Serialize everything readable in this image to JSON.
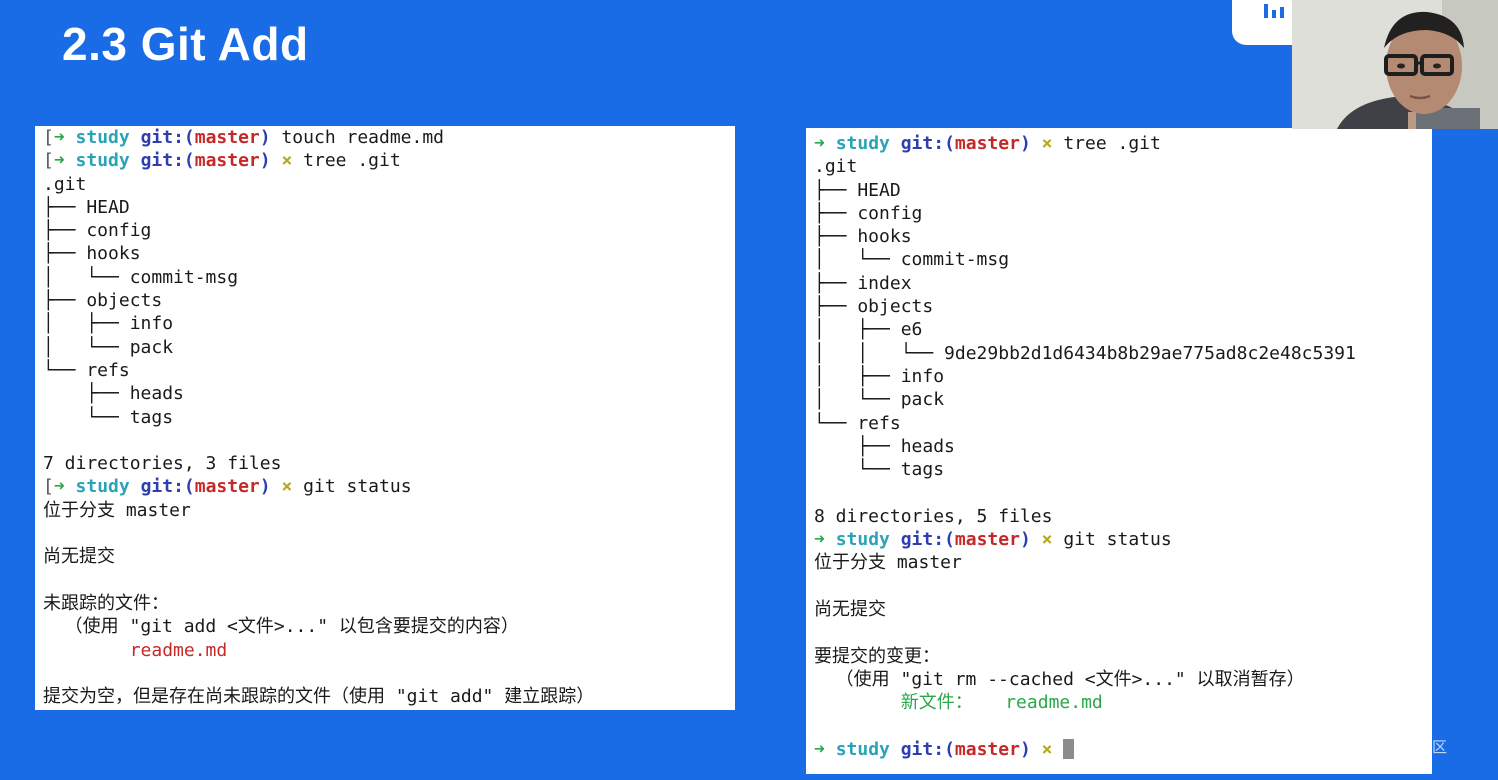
{
  "slide": {
    "title": "2.3 Git Add",
    "watermark": "@稀土掘金技术社区"
  },
  "colors": {
    "background": "#1a6ce6",
    "prompt_arrow": "#2aa84a",
    "prompt_dir": "#2aa3b8",
    "prompt_git": "#2d3fb0",
    "prompt_branch": "#c62828",
    "prompt_dirty_mark": "#b6a916",
    "untracked_file": "#c62828",
    "staged_file": "#2aa84a"
  },
  "prompt": {
    "left_bracket": "[",
    "arrow": "➜",
    "dir": "study",
    "git_prefix": "git:(",
    "branch": "master",
    "git_suffix": ")",
    "dirty_mark": "×"
  },
  "left_terminal": {
    "cmd_touch": "touch readme.md",
    "cmd_tree": "tree .git",
    "tree_lines": [
      ".git",
      "├── HEAD",
      "├── config",
      "├── hooks",
      "│   └── commit-msg",
      "├── objects",
      "│   ├── info",
      "│   └── pack",
      "└── refs",
      "    ├── heads",
      "    └── tags"
    ],
    "tree_summary": "7 directories, 3 files",
    "cmd_status": "git status",
    "status_branch": "位于分支 master",
    "status_no_commits": "尚无提交",
    "status_untracked_header": "未跟踪的文件：",
    "status_untracked_hint": "  （使用 \"git add <文件>...\" 以包含要提交的内容）",
    "untracked_indent": "        ",
    "untracked_file": "readme.md",
    "status_footer": "提交为空，但是存在尚未跟踪的文件（使用 \"git add\" 建立跟踪）"
  },
  "right_terminal": {
    "cmd_tree": "tree .git",
    "tree_lines": [
      ".git",
      "├── HEAD",
      "├── config",
      "├── hooks",
      "│   └── commit-msg",
      "├── index",
      "├── objects",
      "│   ├── e6",
      "│   │   └── 9de29bb2d1d6434b8b29ae775ad8c2e48c5391",
      "│   ├── info",
      "│   └── pack",
      "└── refs",
      "    ├── heads",
      "    └── tags"
    ],
    "tree_summary": "8 directories, 5 files",
    "cmd_status": "git status",
    "status_branch": "位于分支 master",
    "status_no_commits": "尚无提交",
    "status_staged_header": "要提交的变更：",
    "status_staged_hint": "  （使用 \"git rm --cached <文件>...\" 以取消暂存）",
    "staged_indent": "        ",
    "staged_label": "新文件：",
    "staged_gap": "   ",
    "staged_file": "readme.md"
  }
}
